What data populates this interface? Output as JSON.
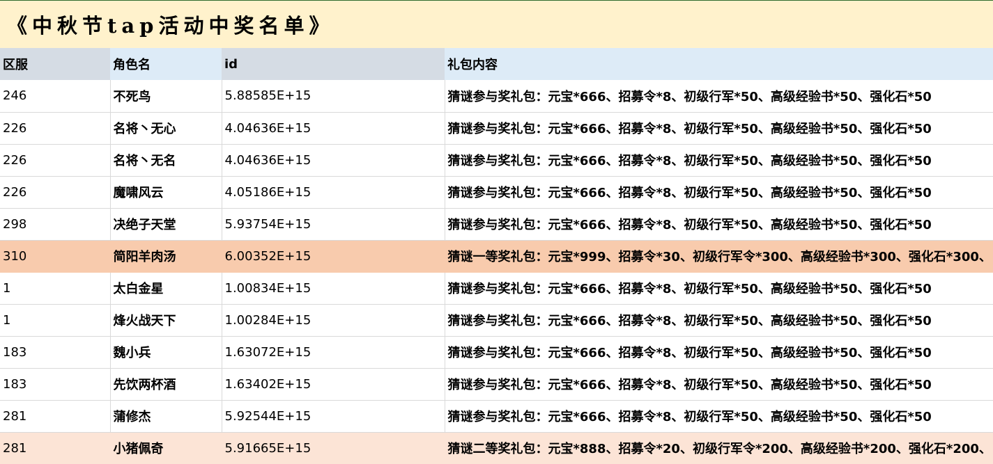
{
  "title": "《中秋节tap活动中奖名单》",
  "columns": {
    "server": "区服",
    "role_name": "角色名",
    "id": "id",
    "gift": "礼包内容"
  },
  "colors": {
    "title_bg": "#fff2cc",
    "header_bg_a": "#d5dce4",
    "header_bg_b": "#ddebf7",
    "first_prize_row": "#f8cbad",
    "second_prize_row": "#fce4d6"
  },
  "rows": [
    {
      "server": "246",
      "name": "不死鸟",
      "id": "5.88585E+15",
      "gift": "猜谜参与奖礼包：元宝*666、招募令*8、初级行军*50、高级经验书*50、强化石*50"
    },
    {
      "server": "226",
      "name": "名将丶无心",
      "id": "4.04636E+15",
      "gift": "猜谜参与奖礼包：元宝*666、招募令*8、初级行军*50、高级经验书*50、强化石*50"
    },
    {
      "server": "226",
      "name": "名将丶无名",
      "id": "4.04636E+15",
      "gift": "猜谜参与奖礼包：元宝*666、招募令*8、初级行军*50、高级经验书*50、强化石*50"
    },
    {
      "server": "226",
      "name": "魔啸风云",
      "id": "4.05186E+15",
      "gift": "猜谜参与奖礼包：元宝*666、招募令*8、初级行军*50、高级经验书*50、强化石*50"
    },
    {
      "server": "298",
      "name": "决绝子天堂",
      "id": "5.93754E+15",
      "gift": "猜谜参与奖礼包：元宝*666、招募令*8、初级行军*50、高级经验书*50、强化石*50"
    },
    {
      "server": "310",
      "name": "简阳羊肉汤",
      "id": "6.00352E+15",
      "gift": "猜谜一等奖礼包：元宝*999、招募令*30、初级行军令*300、高级经验书*300、强化石*300、"
    },
    {
      "server": "1",
      "name": "太白金星",
      "id": "1.00834E+15",
      "gift": "猜谜参与奖礼包：元宝*666、招募令*8、初级行军*50、高级经验书*50、强化石*50"
    },
    {
      "server": "1",
      "name": "烽火战天下",
      "id": "1.00284E+15",
      "gift": "猜谜参与奖礼包：元宝*666、招募令*8、初级行军*50、高级经验书*50、强化石*50"
    },
    {
      "server": "183",
      "name": "魏小兵",
      "id": "1.63072E+15",
      "gift": "猜谜参与奖礼包：元宝*666、招募令*8、初级行军*50、高级经验书*50、强化石*50"
    },
    {
      "server": "183",
      "name": "先饮两杯酒",
      "id": "1.63402E+15",
      "gift": "猜谜参与奖礼包：元宝*666、招募令*8、初级行军*50、高级经验书*50、强化石*50"
    },
    {
      "server": "281",
      "name": "蒲修杰",
      "id": "5.92544E+15",
      "gift": "猜谜参与奖礼包：元宝*666、招募令*8、初级行军*50、高级经验书*50、强化石*50"
    },
    {
      "server": "281",
      "name": "小猪佩奇",
      "id": "5.91665E+15",
      "gift": "猜谜二等奖礼包：元宝*888、招募令*20、初级行军令*200、高级经验书*200、强化石*200、"
    }
  ]
}
